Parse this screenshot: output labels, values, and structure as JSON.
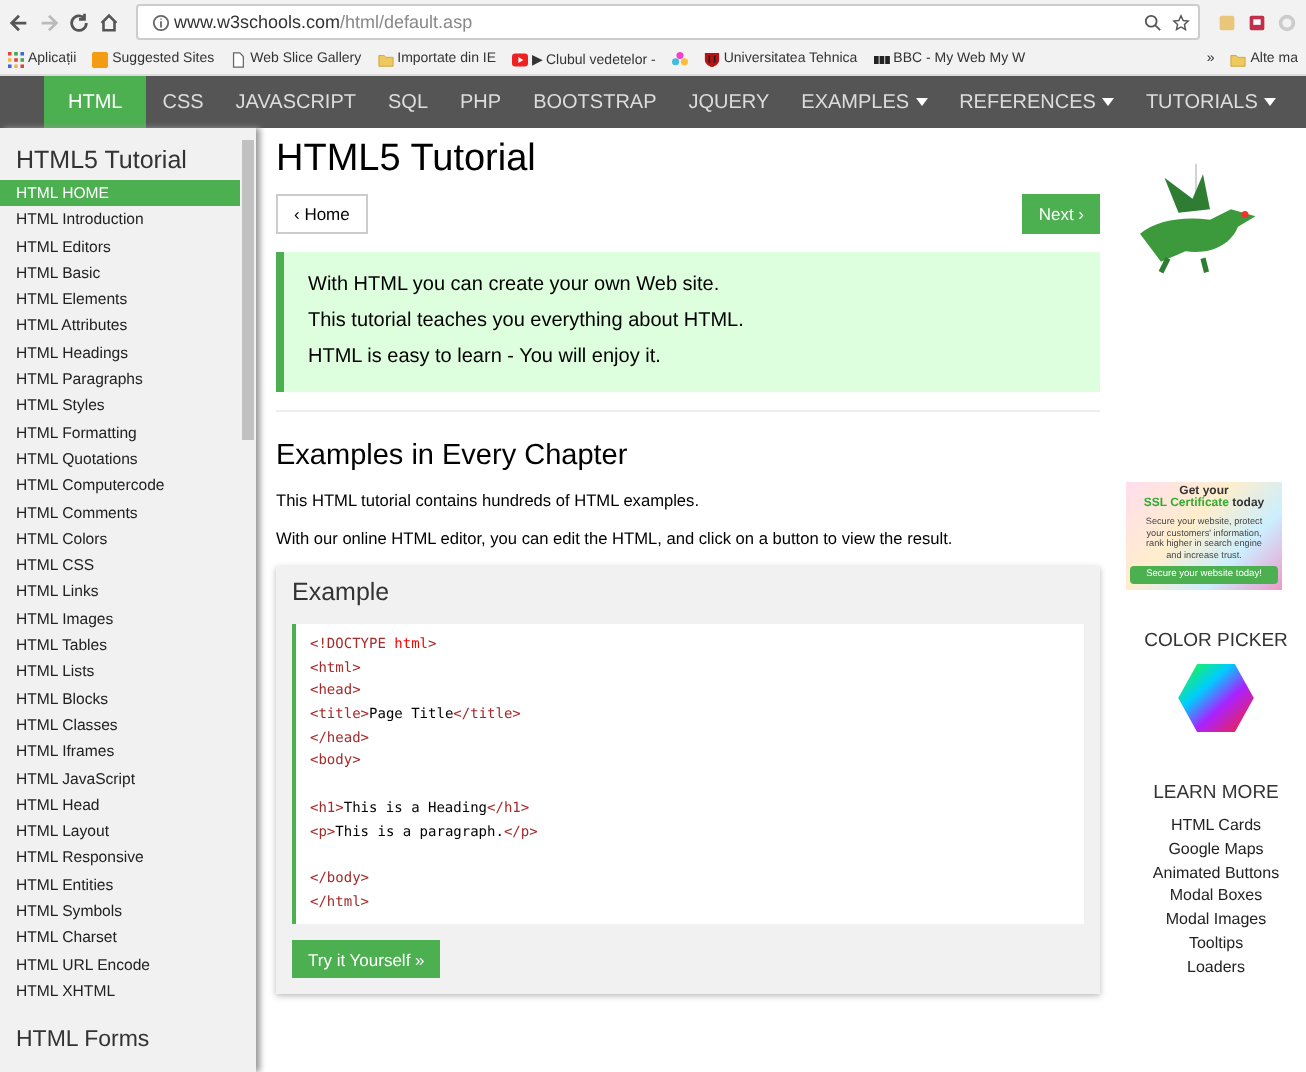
{
  "browser": {
    "url_host": "www.w3schools.com",
    "url_path": "/html/default.asp"
  },
  "bookmarks": [
    {
      "label": "Aplicații",
      "kind": "apps"
    },
    {
      "label": "Suggested Sites",
      "kind": "suggested"
    },
    {
      "label": "Web Slice Gallery",
      "kind": "page"
    },
    {
      "label": "Importate din IE",
      "kind": "folder"
    },
    {
      "label": "▶ Clubul vedetelor -",
      "kind": "video"
    },
    {
      "kind": "flower"
    },
    {
      "label": "Universitatea Tehnica",
      "kind": "shield"
    },
    {
      "label": "BBC - My Web My W",
      "kind": "bbc"
    }
  ],
  "bookmarks_more": "»",
  "bookmarks_other": "Alte ma",
  "nav": [
    {
      "label": "HTML",
      "selected": true,
      "dropdown": false
    },
    {
      "label": "CSS",
      "selected": false,
      "dropdown": false
    },
    {
      "label": "JAVASCRIPT",
      "selected": false,
      "dropdown": false
    },
    {
      "label": "SQL",
      "selected": false,
      "dropdown": false
    },
    {
      "label": "PHP",
      "selected": false,
      "dropdown": false
    },
    {
      "label": "BOOTSTRAP",
      "selected": false,
      "dropdown": false
    },
    {
      "label": "JQUERY",
      "selected": false,
      "dropdown": false
    },
    {
      "label": "EXAMPLES",
      "selected": false,
      "dropdown": true
    },
    {
      "label": "REFERENCES",
      "selected": false,
      "dropdown": true
    },
    {
      "label": "TUTORIALS",
      "selected": false,
      "dropdown": true
    }
  ],
  "sidebar": {
    "title": "HTML5 Tutorial",
    "items": [
      {
        "label": "HTML HOME",
        "selected": true
      },
      {
        "label": "HTML Introduction",
        "selected": false
      },
      {
        "label": "HTML Editors",
        "selected": false
      },
      {
        "label": "HTML Basic",
        "selected": false
      },
      {
        "label": "HTML Elements",
        "selected": false
      },
      {
        "label": "HTML Attributes",
        "selected": false
      },
      {
        "label": "HTML Headings",
        "selected": false
      },
      {
        "label": "HTML Paragraphs",
        "selected": false
      },
      {
        "label": "HTML Styles",
        "selected": false
      },
      {
        "label": "HTML Formatting",
        "selected": false
      },
      {
        "label": "HTML Quotations",
        "selected": false
      },
      {
        "label": "HTML Computercode",
        "selected": false
      },
      {
        "label": "HTML Comments",
        "selected": false
      },
      {
        "label": "HTML Colors",
        "selected": false
      },
      {
        "label": "HTML CSS",
        "selected": false
      },
      {
        "label": "HTML Links",
        "selected": false
      },
      {
        "label": "HTML Images",
        "selected": false
      },
      {
        "label": "HTML Tables",
        "selected": false
      },
      {
        "label": "HTML Lists",
        "selected": false
      },
      {
        "label": "HTML Blocks",
        "selected": false
      },
      {
        "label": "HTML Classes",
        "selected": false
      },
      {
        "label": "HTML Iframes",
        "selected": false
      },
      {
        "label": "HTML JavaScript",
        "selected": false
      },
      {
        "label": "HTML Head",
        "selected": false
      },
      {
        "label": "HTML Layout",
        "selected": false
      },
      {
        "label": "HTML Responsive",
        "selected": false
      },
      {
        "label": "HTML Entities",
        "selected": false
      },
      {
        "label": "HTML Symbols",
        "selected": false
      },
      {
        "label": "HTML Charset",
        "selected": false
      },
      {
        "label": "HTML URL Encode",
        "selected": false
      },
      {
        "label": "HTML XHTML",
        "selected": false
      }
    ],
    "section": "HTML Forms"
  },
  "main": {
    "title": "HTML5 Tutorial",
    "prev": "‹ Home",
    "next": "Next ›",
    "note": [
      "With HTML you can create your own Web site.",
      "This tutorial teaches you everything about HTML.",
      "HTML is easy to learn - You will enjoy it."
    ],
    "heading": "Examples in Every Chapter",
    "paragraphs": [
      "This HTML tutorial contains hundreds of HTML examples.",
      "With our online HTML editor, you can edit the HTML, and click on a button to view the result."
    ],
    "example": {
      "title": "Example",
      "lines": [
        {
          "kind": "code",
          "segments": [
            {
              "kind": "tag",
              "text": "<!DOCTYPE "
            },
            {
              "kind": "attr",
              "text": "html"
            },
            {
              "kind": "tag",
              "text": ">"
            }
          ]
        },
        {
          "kind": "code",
          "segments": [
            {
              "kind": "tag",
              "text": "<html>"
            }
          ]
        },
        {
          "kind": "code",
          "segments": [
            {
              "kind": "tag",
              "text": "<head>"
            }
          ]
        },
        {
          "kind": "code",
          "segments": [
            {
              "kind": "tag",
              "text": "<title>"
            },
            {
              "kind": "text",
              "text": "Page Title"
            },
            {
              "kind": "tag",
              "text": "</title>"
            }
          ]
        },
        {
          "kind": "code",
          "segments": [
            {
              "kind": "tag",
              "text": "</head>"
            }
          ]
        },
        {
          "kind": "code",
          "segments": [
            {
              "kind": "tag",
              "text": "<body>"
            }
          ]
        },
        {
          "kind": "blank"
        },
        {
          "kind": "code",
          "segments": [
            {
              "kind": "tag",
              "text": "<h1>"
            },
            {
              "kind": "text",
              "text": "This is a Heading"
            },
            {
              "kind": "tag",
              "text": "</h1>"
            }
          ]
        },
        {
          "kind": "code",
          "segments": [
            {
              "kind": "tag",
              "text": "<p>"
            },
            {
              "kind": "text",
              "text": "This is a paragraph."
            },
            {
              "kind": "tag",
              "text": "</p>"
            }
          ]
        },
        {
          "kind": "blank"
        },
        {
          "kind": "code",
          "segments": [
            {
              "kind": "tag",
              "text": "</body>"
            }
          ]
        },
        {
          "kind": "code",
          "segments": [
            {
              "kind": "tag",
              "text": "</html>"
            }
          ]
        }
      ],
      "button": "Try it Yourself »"
    }
  },
  "aside": {
    "ad": {
      "line1": "Get your",
      "highlight": "SSL Certificate",
      "line2": " today",
      "body": [
        "Secure your website, protect",
        "your customers' information,",
        "rank higher in search engine",
        "and increase trust."
      ],
      "button": "Secure your website today!"
    },
    "color_picker": "COLOR PICKER",
    "learn_more": "LEARN MORE",
    "links": [
      "HTML Cards",
      "Google Maps",
      "Animated Buttons",
      "Modal Boxes",
      "Modal Images",
      "Tooltips",
      "Loaders"
    ]
  }
}
